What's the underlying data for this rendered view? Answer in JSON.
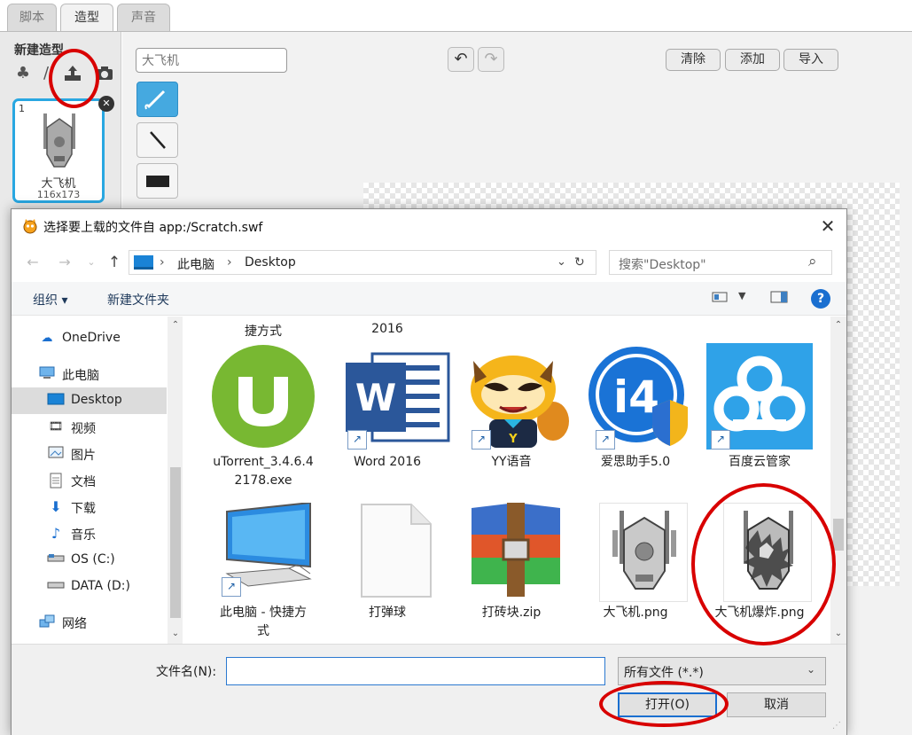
{
  "scratch": {
    "tabs": [
      "脚本",
      "造型",
      "声音"
    ],
    "active_tab_index": 1,
    "new_costume_title": "新建造型",
    "costume_name_value": "大飞机",
    "buttons": {
      "clear": "清除",
      "add": "添加",
      "import": "导入"
    },
    "costume_card": {
      "number": "1",
      "name": "大飞机",
      "size": "116x173"
    }
  },
  "dialog": {
    "title": "选择要上载的文件自 app:/Scratch.swf",
    "address": {
      "root": "此电脑",
      "current": "Desktop"
    },
    "search_placeholder": "搜索\"Desktop\"",
    "toolbar": {
      "organize": "组织 ▾",
      "new_folder": "新建文件夹"
    },
    "sidebar": [
      {
        "label": "OneDrive",
        "icon": "cloud-icon"
      },
      {
        "label": "此电脑",
        "icon": "computer-icon"
      },
      {
        "label": "Desktop",
        "icon": "desktop-icon",
        "selected": true
      },
      {
        "label": "视频",
        "icon": "video-icon"
      },
      {
        "label": "图片",
        "icon": "picture-icon"
      },
      {
        "label": "文档",
        "icon": "document-icon"
      },
      {
        "label": "下载",
        "icon": "download-icon"
      },
      {
        "label": "音乐",
        "icon": "music-icon"
      },
      {
        "label": "OS (C:)",
        "icon": "drive-icon"
      },
      {
        "label": "DATA (D:)",
        "icon": "drive-icon"
      },
      {
        "label": "网络",
        "icon": "network-icon"
      }
    ],
    "partial_captions": [
      "捷方式",
      "2016"
    ],
    "files_row1": [
      {
        "label": "uTorrent_3.4.6.42178.exe",
        "line1": "uTorrent_3.4.6.4",
        "line2": "2178.exe",
        "icon": "utorrent-icon"
      },
      {
        "label": "Word 2016",
        "icon": "word-icon"
      },
      {
        "label": "YY语音",
        "icon": "yy-icon"
      },
      {
        "label": "爱思助手5.0",
        "icon": "i4-icon"
      },
      {
        "label": "百度云管家",
        "icon": "baidu-cloud-icon"
      }
    ],
    "files_row2": [
      {
        "label": "此电脑 - 快捷方式",
        "line1": "此电脑 - 快捷方",
        "line2": "式",
        "icon": "computer-icon"
      },
      {
        "label": "打弹球",
        "icon": "blank-file-icon"
      },
      {
        "label": "打砖块.zip",
        "icon": "winrar-icon"
      },
      {
        "label": "大飞机.png",
        "icon": "plane-image-icon"
      },
      {
        "label": "大飞机爆炸.png",
        "icon": "plane-explosion-image-icon"
      }
    ],
    "filename_label": "文件名(N):",
    "filename_value": "",
    "filetype_value": "所有文件 (*.*)",
    "open_label": "打开(O)",
    "cancel_label": "取消"
  },
  "colors": {
    "accent": "#1a6fd0",
    "annotation": "#d80000",
    "scratch_selected": "#29a7e1"
  }
}
